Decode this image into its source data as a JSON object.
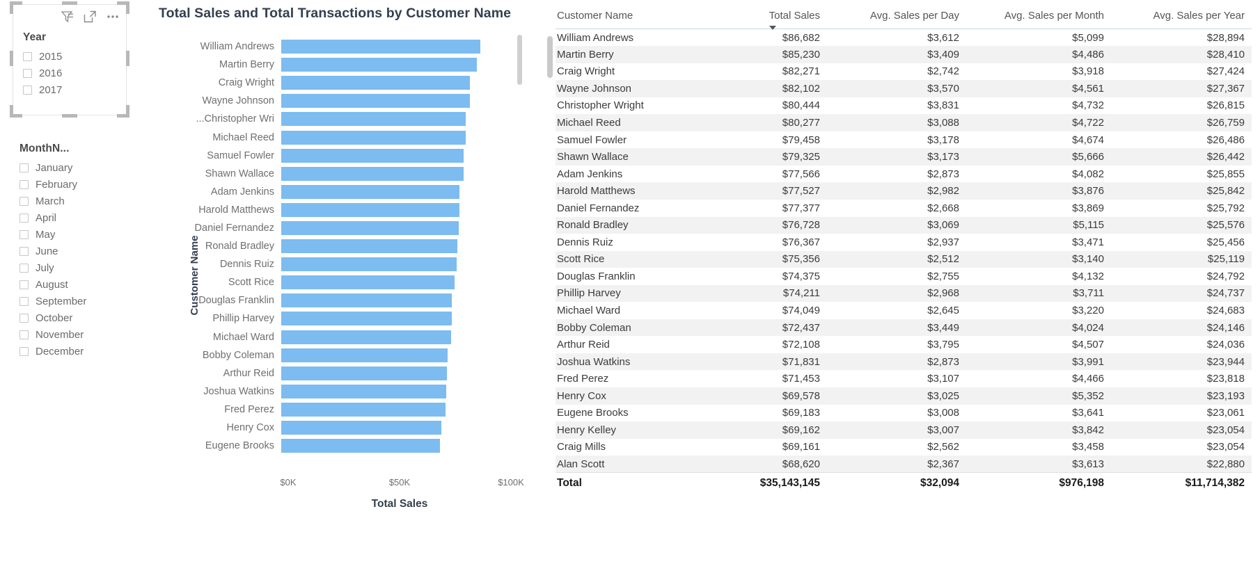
{
  "slicers": {
    "year": {
      "title": "Year",
      "icons": [
        "filter-icon",
        "focus-mode-icon",
        "more-options-icon"
      ],
      "items": [
        {
          "label": "2015",
          "checked": false
        },
        {
          "label": "2016",
          "checked": false
        },
        {
          "label": "2017",
          "checked": false
        }
      ]
    },
    "month": {
      "title": "MonthN...",
      "items": [
        {
          "label": "January",
          "checked": false
        },
        {
          "label": "February",
          "checked": false
        },
        {
          "label": "March",
          "checked": false
        },
        {
          "label": "April",
          "checked": false
        },
        {
          "label": "May",
          "checked": false
        },
        {
          "label": "June",
          "checked": false
        },
        {
          "label": "July",
          "checked": false
        },
        {
          "label": "August",
          "checked": false
        },
        {
          "label": "September",
          "checked": false
        },
        {
          "label": "October",
          "checked": false
        },
        {
          "label": "November",
          "checked": false
        },
        {
          "label": "December",
          "checked": false
        }
      ]
    }
  },
  "chart_data": {
    "type": "bar",
    "orientation": "horizontal",
    "title": "Total Sales and Total Transactions by Customer Name",
    "xlabel": "Total Sales",
    "ylabel": "Customer Name",
    "xlim": [
      0,
      100000
    ],
    "xticks": [
      0,
      50000,
      100000
    ],
    "xtick_labels": [
      "$0K",
      "$50K",
      "$100K"
    ],
    "grid": false,
    "legend": false,
    "bar_color": "#7CBCF0",
    "categories": [
      "William Andrews",
      "Martin Berry",
      "Craig Wright",
      "Wayne Johnson",
      "Christopher Wri...",
      "Michael Reed",
      "Samuel Fowler",
      "Shawn Wallace",
      "Adam Jenkins",
      "Harold Matthews",
      "Daniel Fernandez",
      "Ronald Bradley",
      "Dennis Ruiz",
      "Scott Rice",
      "Douglas Franklin",
      "Phillip Harvey",
      "Michael Ward",
      "Bobby Coleman",
      "Arthur Reid",
      "Joshua Watkins",
      "Fred Perez",
      "Henry Cox",
      "Eugene Brooks"
    ],
    "values": [
      86682,
      85230,
      82271,
      82102,
      80444,
      80277,
      79458,
      79325,
      77566,
      77527,
      77377,
      76728,
      76367,
      75356,
      74375,
      74211,
      74049,
      72437,
      72108,
      71831,
      71453,
      69578,
      69183
    ]
  },
  "table": {
    "columns": [
      {
        "label": "Customer Name",
        "align": "left",
        "sorted": false
      },
      {
        "label": "Total Sales",
        "align": "right",
        "sorted": true,
        "direction": "desc"
      },
      {
        "label": "Avg. Sales per Day",
        "align": "right",
        "sorted": false
      },
      {
        "label": "Avg. Sales per Month",
        "align": "right",
        "sorted": false
      },
      {
        "label": "Avg. Sales per Year",
        "align": "right",
        "sorted": false
      }
    ],
    "rows": [
      [
        "William Andrews",
        "$86,682",
        "$3,612",
        "$5,099",
        "$28,894"
      ],
      [
        "Martin Berry",
        "$85,230",
        "$3,409",
        "$4,486",
        "$28,410"
      ],
      [
        "Craig Wright",
        "$82,271",
        "$2,742",
        "$3,918",
        "$27,424"
      ],
      [
        "Wayne Johnson",
        "$82,102",
        "$3,570",
        "$4,561",
        "$27,367"
      ],
      [
        "Christopher Wright",
        "$80,444",
        "$3,831",
        "$4,732",
        "$26,815"
      ],
      [
        "Michael Reed",
        "$80,277",
        "$3,088",
        "$4,722",
        "$26,759"
      ],
      [
        "Samuel Fowler",
        "$79,458",
        "$3,178",
        "$4,674",
        "$26,486"
      ],
      [
        "Shawn Wallace",
        "$79,325",
        "$3,173",
        "$5,666",
        "$26,442"
      ],
      [
        "Adam Jenkins",
        "$77,566",
        "$2,873",
        "$4,082",
        "$25,855"
      ],
      [
        "Harold Matthews",
        "$77,527",
        "$2,982",
        "$3,876",
        "$25,842"
      ],
      [
        "Daniel Fernandez",
        "$77,377",
        "$2,668",
        "$3,869",
        "$25,792"
      ],
      [
        "Ronald Bradley",
        "$76,728",
        "$3,069",
        "$5,115",
        "$25,576"
      ],
      [
        "Dennis Ruiz",
        "$76,367",
        "$2,937",
        "$3,471",
        "$25,456"
      ],
      [
        "Scott Rice",
        "$75,356",
        "$2,512",
        "$3,140",
        "$25,119"
      ],
      [
        "Douglas Franklin",
        "$74,375",
        "$2,755",
        "$4,132",
        "$24,792"
      ],
      [
        "Phillip Harvey",
        "$74,211",
        "$2,968",
        "$3,711",
        "$24,737"
      ],
      [
        "Michael Ward",
        "$74,049",
        "$2,645",
        "$3,220",
        "$24,683"
      ],
      [
        "Bobby Coleman",
        "$72,437",
        "$3,449",
        "$4,024",
        "$24,146"
      ],
      [
        "Arthur Reid",
        "$72,108",
        "$3,795",
        "$4,507",
        "$24,036"
      ],
      [
        "Joshua Watkins",
        "$71,831",
        "$2,873",
        "$3,991",
        "$23,944"
      ],
      [
        "Fred Perez",
        "$71,453",
        "$3,107",
        "$4,466",
        "$23,818"
      ],
      [
        "Henry Cox",
        "$69,578",
        "$3,025",
        "$5,352",
        "$23,193"
      ],
      [
        "Eugene Brooks",
        "$69,183",
        "$3,008",
        "$3,641",
        "$23,061"
      ],
      [
        "Henry Kelley",
        "$69,162",
        "$3,007",
        "$3,842",
        "$23,054"
      ],
      [
        "Craig Mills",
        "$69,161",
        "$2,562",
        "$3,458",
        "$23,054"
      ],
      [
        "Alan Scott",
        "$68,620",
        "$2,367",
        "$3,613",
        "$22,880"
      ]
    ],
    "total_row": [
      "Total",
      "$35,143,145",
      "$32,094",
      "$976,198",
      "$11,714,382"
    ]
  }
}
